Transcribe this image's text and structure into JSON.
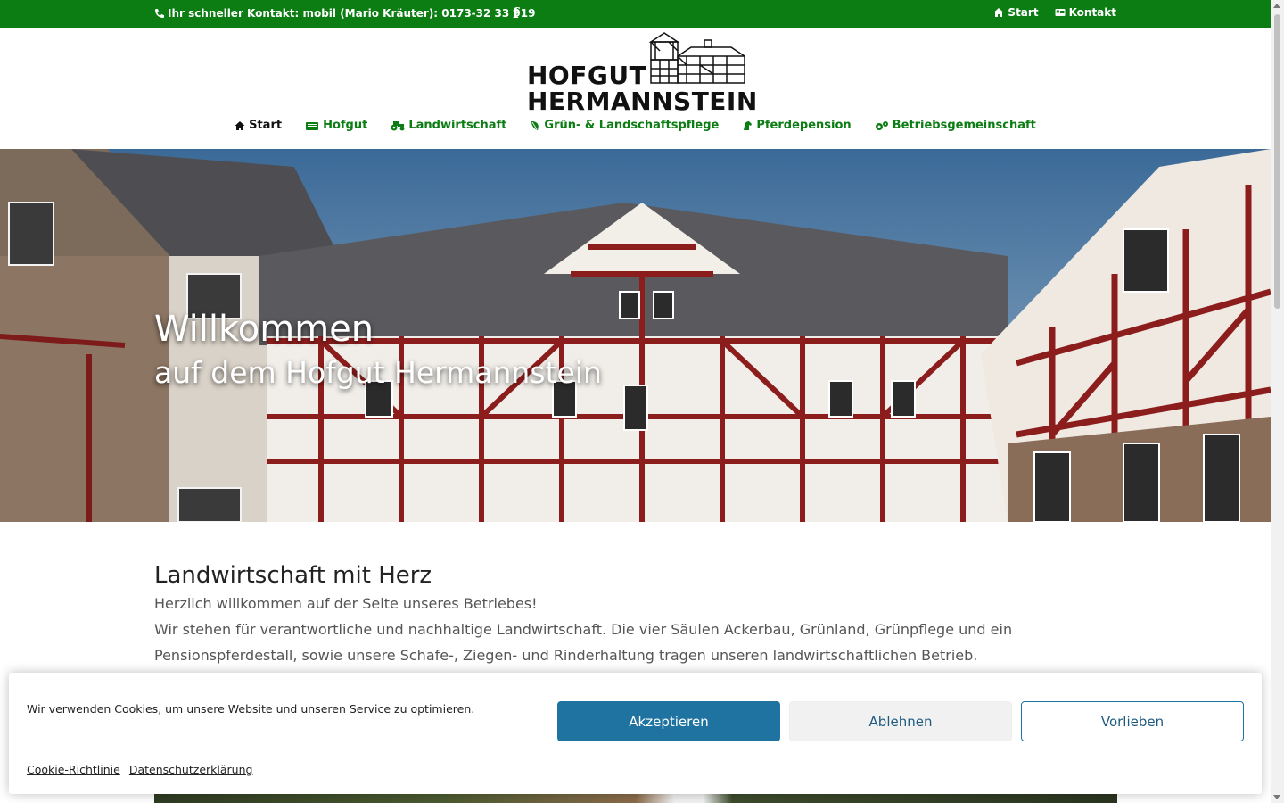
{
  "topbar": {
    "contact_text": "Ihr schneller Kontakt: mobil (Mario Kräuter): 0173-32 33 919",
    "facebook_glyph": "f",
    "links": [
      {
        "label": "Start",
        "icon": "home-icon"
      },
      {
        "label": "Kontakt",
        "icon": "address-card-icon"
      }
    ]
  },
  "logo": {
    "line1": "HOFGUT",
    "line2": "HERMANNSTEIN"
  },
  "nav": {
    "items": [
      {
        "label": "Start",
        "icon": "home-icon"
      },
      {
        "label": "Hofgut",
        "icon": "building-icon"
      },
      {
        "label": "Landwirtschaft",
        "icon": "tractor-icon"
      },
      {
        "label": "Grün- & Landschaftspflege",
        "icon": "leaf-icon"
      },
      {
        "label": "Pferdepension",
        "icon": "horse-icon"
      },
      {
        "label": "Betriebsgemeinschaft",
        "icon": "gears-icon"
      }
    ]
  },
  "hero": {
    "title": "Willkommen",
    "subtitle": "auf dem Hofgut Hermannstein"
  },
  "content": {
    "heading": "Landwirtschaft mit Herz",
    "para1": "Herzlich willkommen auf der Seite unseres Betriebes!",
    "para2": "Wir stehen für verantwortliche und nachhaltige Landwirtschaft. Die vier Säulen Ackerbau, Grünland, Grünpflege und ein Pensionspferdestall, sowie unsere Schafe-, Ziegen- und Rinderhaltung tragen unseren landwirtschaftlichen Betrieb."
  },
  "cookie": {
    "message": "Wir verwenden Cookies, um unsere Website und unseren Service zu optimieren.",
    "accept": "Akzeptieren",
    "deny": "Ablehnen",
    "preferences": "Vorlieben",
    "link_policy": "Cookie-Richtlinie",
    "link_privacy": "Datenschutzerklärung"
  },
  "colors": {
    "brand_green": "#0b7d13",
    "accept_blue": "#1e73a0"
  }
}
